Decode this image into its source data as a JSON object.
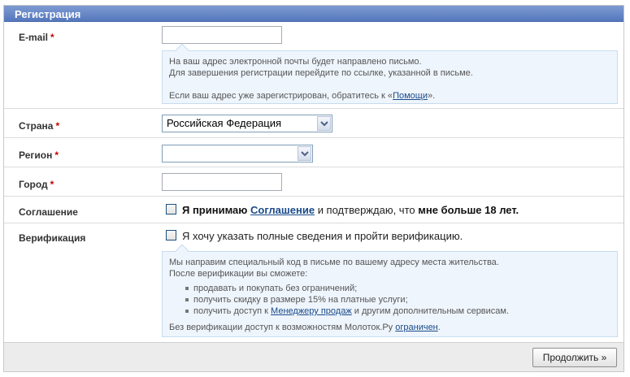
{
  "header": {
    "title": "Регистрация"
  },
  "email": {
    "label": "E-mail",
    "required_mark": "*",
    "value": "",
    "info_line1": "На ваш адрес электронной почты будет направлено письмо.",
    "info_line2": "Для завершения регистрации перейдите по ссылке, указанной в письме.",
    "info_line3_prefix": "Если ваш адрес уже зарегистрирован, обратитесь к «",
    "info_help_link": "Помощи",
    "info_line3_suffix": "»."
  },
  "country": {
    "label": "Страна",
    "required_mark": "*",
    "selected": "Российская Федерация"
  },
  "region": {
    "label": "Регион",
    "required_mark": "*",
    "selected": ""
  },
  "city": {
    "label": "Город",
    "required_mark": "*",
    "value": ""
  },
  "agreement": {
    "label": "Соглашение",
    "part1": "Я принимаю",
    "link": "Соглашение",
    "part2": "и подтверждаю, что",
    "part3": "мне больше 18 лет.",
    "checked": false
  },
  "verification": {
    "label": "Верификация",
    "checkbox_text": "Я хочу указать полные сведения и пройти верификацию.",
    "checked": false,
    "info_line1": "Мы направим специальный код в письме по вашему адресу места жительства.",
    "info_line2": "После верификации вы сможете:",
    "benefits": [
      "продавать и покупать без ограничений;",
      "получить скидку в размере 15% на платные услуги;"
    ],
    "benefit3_prefix": "получить доступ к",
    "benefit3_link": "Менеджеру продаж",
    "benefit3_suffix": "и другим дополнительным сервисам.",
    "footer_prefix": "Без верификации доступ к возможностям Молоток.Ру",
    "footer_link": "ограничен",
    "footer_suffix": "."
  },
  "footer": {
    "continue_label": "Продолжить »"
  }
}
